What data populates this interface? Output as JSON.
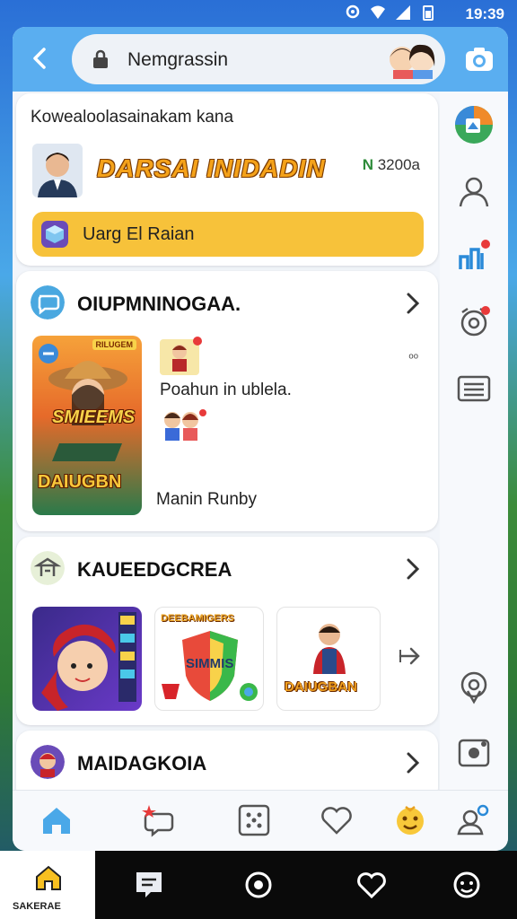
{
  "status": {
    "time": "19:39"
  },
  "search": {
    "text": "Nemgrassin"
  },
  "profile": {
    "breadcrumb": "Kowealoolasainakam kana",
    "game_title": "DARSAI INIDADIN",
    "code_letter": "N",
    "code_value": "3200a",
    "button_label": "Uarg El Raian"
  },
  "section1": {
    "title": "OIUPMNINOGAA.",
    "tile_badge": "RILUGEM",
    "tile_top": "SMIEEMS",
    "tile_bottom": "DAIUGBN",
    "side_label_1": "Poahun in ublela.",
    "side_label_2": "Manin Runby",
    "extra_mark": "ᵒᵒ"
  },
  "section2": {
    "title": "KAUEEDGCREA",
    "tile2_top": "DEEBAMIGERS",
    "tile2_mid": "SIMMIS",
    "tile3_label": "DAIUGBAN"
  },
  "section3": {
    "title": "MAIDAGKOIA"
  },
  "nav": {
    "home_label": "SAKERAE"
  },
  "colors": {
    "accent": "#5aaef0",
    "yellow": "#f7c23a",
    "brand_orange": "#f4a21a"
  }
}
